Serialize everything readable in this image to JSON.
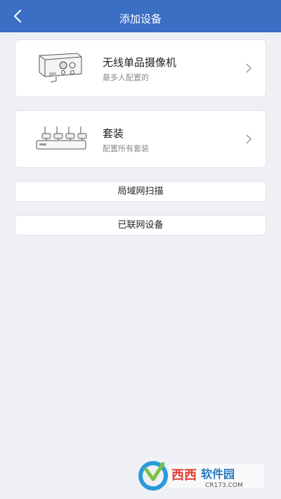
{
  "header": {
    "title": "添加设备",
    "back_icon": "chevron-left-icon",
    "color": "#3a6fc4"
  },
  "devices": [
    {
      "name": "无线单品摄像机",
      "subtitle": "最多人配置的",
      "icon": "bullet-camera-icon"
    },
    {
      "name": "套装",
      "subtitle": "配置所有套装",
      "icon": "nvr-kit-icon"
    }
  ],
  "actions": {
    "lan_scan": "局域网扫描",
    "connected_devices": "已联网设备"
  },
  "watermark": {
    "brand": "西西软件园",
    "url": "CR173.COM"
  }
}
